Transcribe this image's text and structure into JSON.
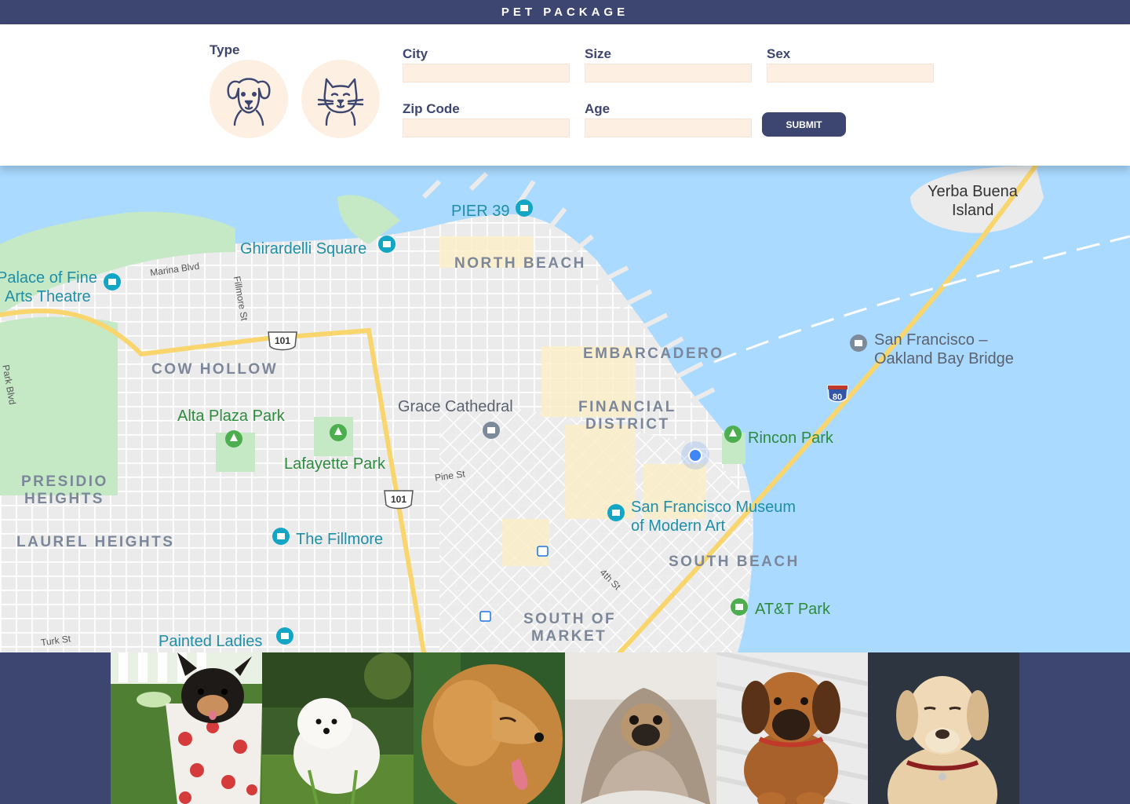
{
  "header": {
    "title": "PET PACKAGE"
  },
  "form": {
    "type_label": "Type",
    "type_options": [
      {
        "name": "dog",
        "icon": "dog-face-icon"
      },
      {
        "name": "cat",
        "icon": "cat-face-icon"
      }
    ],
    "fields": {
      "city": {
        "label": "City",
        "value": ""
      },
      "size": {
        "label": "Size",
        "value": ""
      },
      "sex": {
        "label": "Sex",
        "value": ""
      },
      "zip": {
        "label": "Zip Code",
        "value": ""
      },
      "age": {
        "label": "Age",
        "value": ""
      }
    },
    "submit_label": "SUBMIT"
  },
  "map": {
    "districts": {
      "north_beach": "NORTH BEACH",
      "embarcadero": "EMBARCADERO",
      "financial_district_1": "FINANCIAL",
      "financial_district_2": "DISTRICT",
      "cow_hollow": "COW HOLLOW",
      "presidio_heights_1": "PRESIDIO",
      "presidio_heights_2": "HEIGHTS",
      "laurel_heights": "LAUREL HEIGHTS",
      "south_beach": "SOUTH BEACH",
      "south_of_market_1": "SOUTH OF",
      "south_of_market_2": "MARKET"
    },
    "places": {
      "pier39": "PIER 39",
      "ghirardelli": "Ghirardelli Square",
      "palace_1": "Palace of Fine",
      "palace_2": "Arts Theatre",
      "yerba_1": "Yerba Buena",
      "yerba_2": "Island",
      "bay_bridge_1": "San Francisco –",
      "bay_bridge_2": "Oakland Bay Bridge",
      "grace": "Grace Cathedral",
      "alta_plaza": "Alta Plaza Park",
      "lafayette": "Lafayette Park",
      "rincon": "Rincon Park",
      "sfmoma_1": "San Francisco Museum",
      "sfmoma_2": "of Modern Art",
      "fillmore": "The Fillmore",
      "att_park": "AT&T Park",
      "painted_ladies": "Painted Ladies"
    },
    "streets": {
      "marina": "Marina Blvd",
      "fillmore_st": "Fillmore St",
      "pine": "Pine St",
      "fourth": "4th St",
      "turk": "Turk St",
      "park_blvd": "Park Blvd"
    },
    "highway_shields": [
      "101",
      "101",
      "80"
    ],
    "colors": {
      "water": "#aadaff",
      "park": "#c5e8c5",
      "land": "#ebebeb",
      "highway": "#f8d66d",
      "pin_poi": "#12a5c4",
      "pin_park": "#4cae4f",
      "location": "#4285f4"
    }
  },
  "gallery": {
    "photos": [
      {
        "subject": "chihuahua-puppy-in-polka-dot-cup"
      },
      {
        "subject": "white-maltese-puppy-in-grass"
      },
      {
        "subject": "golden-retriever-portrait"
      },
      {
        "subject": "pug-in-blanket"
      },
      {
        "subject": "brown-puppy-with-red-collar"
      },
      {
        "subject": "yellow-labrador-portrait"
      }
    ]
  },
  "theme": {
    "primary": "#3d4670",
    "input_bg": "#fdf0e3"
  }
}
